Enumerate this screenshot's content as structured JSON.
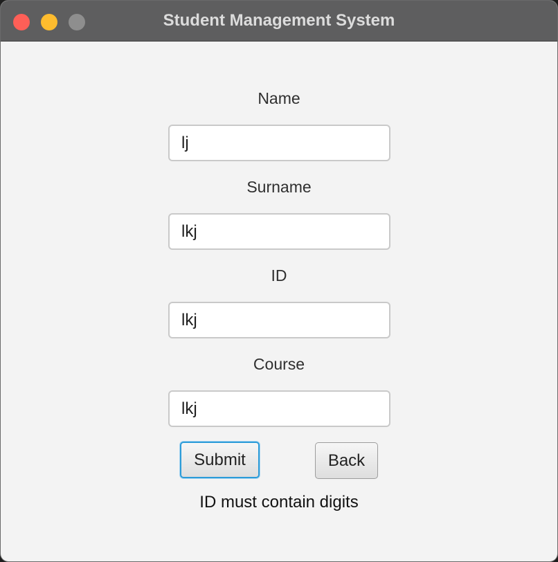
{
  "window": {
    "title": "Student Management System"
  },
  "form": {
    "name_label": "Name",
    "name_value": "lj",
    "surname_label": "Surname",
    "surname_value": "lkj",
    "id_label": "ID",
    "id_value": "lkj",
    "course_label": "Course",
    "course_value": "lkj"
  },
  "buttons": {
    "submit_label": "Submit",
    "back_label": "Back"
  },
  "status": {
    "message": "ID must contain digits"
  },
  "colors": {
    "titlebar": "#5e5e5f",
    "window_background": "#f3f3f3",
    "close": "#fe5f57",
    "minimize": "#febc2e",
    "zoom_inactive": "#8e8e8e",
    "focus_ring": "#2b9bd8"
  }
}
